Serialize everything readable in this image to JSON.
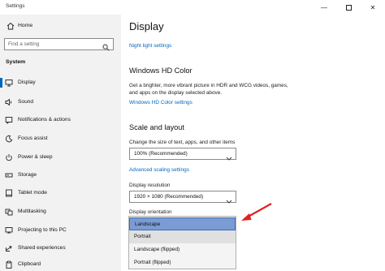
{
  "window": {
    "title": "Settings"
  },
  "sidebar": {
    "home_label": "Home",
    "search_placeholder": "Find a setting",
    "section_label": "System",
    "items": [
      {
        "label": "Display",
        "icon": "monitor-icon",
        "active": true
      },
      {
        "label": "Sound",
        "icon": "speaker-icon"
      },
      {
        "label": "Notifications & actions",
        "icon": "notification-icon"
      },
      {
        "label": "Focus assist",
        "icon": "moon-icon"
      },
      {
        "label": "Power & sleep",
        "icon": "power-icon"
      },
      {
        "label": "Storage",
        "icon": "storage-icon"
      },
      {
        "label": "Tablet mode",
        "icon": "tablet-icon"
      },
      {
        "label": "Multitasking",
        "icon": "multitasking-icon"
      },
      {
        "label": "Projecting to this PC",
        "icon": "projector-icon"
      },
      {
        "label": "Shared experiences",
        "icon": "shared-experiences-icon"
      },
      {
        "label": "Clipboard",
        "icon": "clipboard-icon"
      }
    ]
  },
  "main": {
    "title": "Display",
    "night_light_link": "Night light settings",
    "hd_color": {
      "heading": "Windows HD Color",
      "description_line1": "Get a brighter, more vibrant picture in HDR and WCG videos, games,",
      "description_line2": "and apps on the display selected above.",
      "link": "Windows HD Color settings"
    },
    "scale_layout": {
      "heading": "Scale and layout",
      "size_label": "Change the size of text, apps, and other items",
      "size_value": "100% (Recommended)",
      "advanced_link": "Advanced scaling settings",
      "resolution_label": "Display resolution",
      "resolution_value": "1920 × 1080 (Recommended)",
      "orientation_label": "Display orientation"
    },
    "orientation_options": [
      "Landscape",
      "Portrait",
      "Landscape (flipped)",
      "Portrait (flipped)"
    ],
    "orientation_selected": "Landscape"
  },
  "colors": {
    "accent": "#0067c0",
    "selected_option": "#7a9bd3",
    "annotation_arrow": "#e02020",
    "sidebar_bg": "#f2f2f2"
  }
}
